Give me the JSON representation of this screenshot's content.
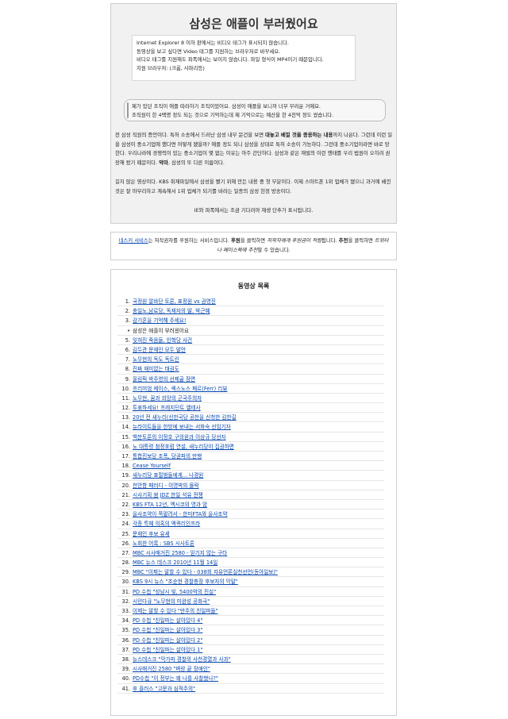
{
  "article": {
    "title": "삼성은 애플이 부러웠어요",
    "notice_lines": [
      "Internet Explorer 8 이하 판에서는 비디오 태그가 표시되지 않습니다.",
      "동영상을 보고 싶다면 Video 태그를 지원하는 브라우저로 바꾸세요.",
      "비디오 태그를 지원해도 파폭에서는 보이지 않습니다. 파일 형식이 MP4이기 때문입니다.",
      "지원 브라우저: (크롬, 사파리등)"
    ],
    "quote_lines": [
      "제가 있던 조직이 애플 따라하기 조직이었어요. 삼성이 애플을 보니까 너무 부러운 거예요.",
      "조직원이 한 4백명 정도 되는 것으로 기억하는데 제 기억으로는 예산을 한 4천억 정도 썼습니다."
    ],
    "p1_a": "전 삼성 직원의 증언이다. 특허 소송에서 드러난 삼성 내부 문건을 보면 ",
    "p1_b": "대놓고 베낄 것을 종용하는 내용",
    "p1_c": "까지 나온다. 그런데 이런 일을 삼성이 중소기업에 했다면 어떻게 됐을까? 애플 정도 되니 삼성을 상대로 특허 소송이 가능하다. 그런데 중소기업이라면 바로 망한다. 우리나라에 경쟁력이 있는 중소기업이 몇 없는 이유는 아주 간단하다. 삼성과 같은 재벌의 이런 행태를 우리 법원이 오히려 권장해 왔기 때문이다. ",
    "p1_d": "악마",
    "p1_e": ", 삼성의 또 다른 이름이다.",
    "p2": "길지 않은 영상이다. KBS 취재파일에서 삼성을 빨기 위해 만든 내용 중 첫 부분이다. 이제 스마트폰 1위 업체가 됐으니 과거에 베낀 것은 잘 마무리하고 계속해서 1위 업체가 되기를 바라는 일종의 삼성 헌정 방송이다.",
    "ie_note": "IE와 파폭에서는 조금 기다려야 재생 단추가 표시됩니다."
  },
  "sponsor": {
    "link": "네스커 서비스",
    "t1": "는 저작권자를 후원하는 서비스입니다. ",
    "b1": "후원",
    "t2": "을 클릭하면 ",
    "i1": "저작자에게 후원금이 적립",
    "t3": "됩니다. ",
    "b2": "추천",
    "t4": "을 클릭하면 ",
    "i2": "트위터나 페이스북에 추천",
    "t5": "할 수 있습니다."
  },
  "video_list": {
    "title": "동영상 목록",
    "items": [
      {
        "num": "1.",
        "text": "국정원 알바단 토론, 표정원 vs 권영진",
        "link": true
      },
      {
        "num": "2.",
        "text": "충일노,남로당, 독재자의 딸, 박근혜",
        "link": true
      },
      {
        "num": "3.",
        "text": "감기혼을 기억해 주세요!",
        "link": true
      },
      {
        "num": "•",
        "text": "삼성은 애플이 부러웠어요",
        "link": false
      },
      {
        "num": "5.",
        "text": "잊혀진 죽음들, 인혁당 사건",
        "link": true
      },
      {
        "num": "6.",
        "text": "김두관 문재인 모두 발언",
        "link": true
      },
      {
        "num": "7.",
        "text": "노무현의 독도 독트린",
        "link": true
      },
      {
        "num": "8.",
        "text": "진짜 재미없는 태권도",
        "link": true
      },
      {
        "num": "9.",
        "text": "올림픽 박주영의 선제골 장면",
        "link": true
      },
      {
        "num": "10.",
        "text": "프리미엄 케이스, 렉스노스 페르(Ferr) 리뷰",
        "link": true
      },
      {
        "num": "11.",
        "text": "노무현, 꿈과 희망의 군국주의자",
        "link": true
      },
      {
        "num": "12.",
        "text": "투표하세요! 프레지던트 엘테사",
        "link": true
      },
      {
        "num": "13.",
        "text": "20년 전 새누리(신한국당 공천을 신청한 김한길",
        "link": true
      },
      {
        "num": "14.",
        "text": "뉴라이트들을 한방에 보내는 서화숙 선임기자",
        "link": true
      },
      {
        "num": "15.",
        "text": "백분토론의 이정호 구의원과 이상규 당선자",
        "link": true
      },
      {
        "num": "16.",
        "text": "노 대통령 참정포럼 연설, 새누리당이 집권하면",
        "link": true
      },
      {
        "num": "17.",
        "text": "통합진보당 조폭, 당권파의 만행",
        "link": true
      },
      {
        "num": "18.",
        "text": "Cease Yourself",
        "link": true
      },
      {
        "num": "19.",
        "text": "새누리당 표절범들에게... 나경원",
        "link": true
      },
      {
        "num": "20.",
        "text": "천안함 패러디 - 이명박의 몰락",
        "link": true
      },
      {
        "num": "21.",
        "text": "시사기획 쌈 JDZ 한일 석유 전쟁",
        "link": true
      },
      {
        "num": "22.",
        "text": "KBS FTA 12년, 멕시코의 명과 암",
        "link": true
      },
      {
        "num": "23.",
        "text": "을사조약이 쪽팔려서 - 한미FTA와 을사조약",
        "link": true
      },
      {
        "num": "24.",
        "text": "각종 특혜 의혹의 액퀴리인프라",
        "link": true
      },
      {
        "num": "25.",
        "text": "문재인 후보 유세",
        "link": true
      },
      {
        "num": "26.",
        "text": "노회찬 어록 : SBS 시사토론",
        "link": true
      },
      {
        "num": "27.",
        "text": "MBC 시사매거진 2580 - 믿기지 않는 구타",
        "link": true
      },
      {
        "num": "28.",
        "text": "MBC 뉴스 데스크 2010년 11월 14일",
        "link": true
      },
      {
        "num": "29.",
        "text": "MBC \"이제는 말할 수 있다 - 038회 자유언론실천선언(동아일보)\"",
        "link": true
      },
      {
        "num": "30.",
        "text": "KBS 9시 뉴스 \"조순현 경찰총장 후보자의 막말\"",
        "link": true
      },
      {
        "num": "31.",
        "text": "PD 수첩 \"성남시 빚, 5400억의 진실\"",
        "link": true
      },
      {
        "num": "32.",
        "text": "시민다큐 \"노무현의 미완성 공화국\"",
        "link": true
      },
      {
        "num": "33.",
        "text": "이제는 말할 수 있다 \"만주의 친일파들\"",
        "link": true
      },
      {
        "num": "34.",
        "text": "PD 수첩 \"친일파는 살아있다 4\"",
        "link": true
      },
      {
        "num": "35.",
        "text": "PD 수첩 \"친일파는 살아있다 3\"",
        "link": true
      },
      {
        "num": "36.",
        "text": "PD 수첩 \"친일파는 살아있다 2\"",
        "link": true
      },
      {
        "num": "37.",
        "text": "PD 수첩 \"친일파는 살아있다 1\"",
        "link": true
      },
      {
        "num": "38.",
        "text": "뉴스데스크 \"막가파 경찰의 사천경열과 사과\"",
        "link": true
      },
      {
        "num": "39.",
        "text": "시사매거진 2580 \"벼랑 끝 장애인\"",
        "link": true
      },
      {
        "num": "40.",
        "text": "PD수첩 \"이 정부는 왜 나를 사찰했나?\"",
        "link": true
      },
      {
        "num": "41.",
        "text": "후 플러스 \"고문과 심적주의\"",
        "link": true
      }
    ]
  }
}
